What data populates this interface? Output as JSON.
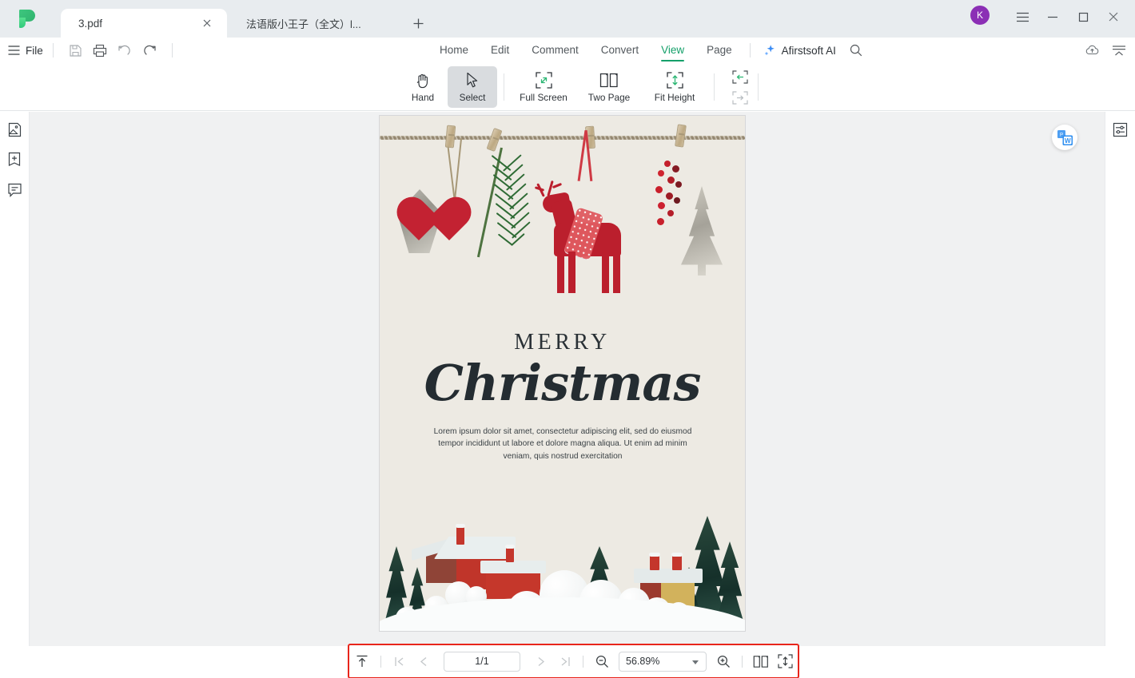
{
  "window": {
    "logo_icon": "afirstsoft-leaf-logo",
    "tabs": [
      {
        "label": "3.pdf",
        "active": true,
        "close_icon": "close-icon"
      },
      {
        "label": "法语版小王子（全文）l...",
        "active": false
      }
    ],
    "new_tab_icon": "plus-icon",
    "avatar_initial": "K",
    "controls": [
      {
        "name": "app-menu",
        "icon": "hamburger-icon"
      },
      {
        "name": "minimize",
        "icon": "minimize-icon"
      },
      {
        "name": "maximize",
        "icon": "maximize-icon"
      },
      {
        "name": "close",
        "icon": "close-icon"
      }
    ]
  },
  "menubar": {
    "hamburger_icon": "hamburger-icon",
    "file_label": "File",
    "quick_icons": [
      {
        "name": "save",
        "icon": "save-icon"
      },
      {
        "name": "print",
        "icon": "print-icon"
      },
      {
        "name": "undo",
        "icon": "undo-icon"
      },
      {
        "name": "redo",
        "icon": "redo-icon"
      }
    ],
    "tabs": [
      {
        "label": "Home",
        "active": false
      },
      {
        "label": "Edit",
        "active": false
      },
      {
        "label": "Comment",
        "active": false
      },
      {
        "label": "Convert",
        "active": false
      },
      {
        "label": "View",
        "active": true
      },
      {
        "label": "Page",
        "active": false
      }
    ],
    "ai_label": "Afirstsoft AI",
    "ai_icon": "sparkle-icon",
    "search_icon": "search-icon",
    "cloud_icon": "cloud-upload-icon",
    "collapse_icon": "collapse-ribbon-icon"
  },
  "ribbon": {
    "tools": [
      {
        "label": "Hand",
        "icon": "hand-icon",
        "selected": false
      },
      {
        "label": "Select",
        "icon": "cursor-arrow-icon",
        "selected": true
      },
      {
        "label": "Full Screen",
        "icon": "full-screen-icon",
        "selected": false
      },
      {
        "label": "Two Page",
        "icon": "two-page-icon",
        "selected": false
      },
      {
        "label": "Fit Height",
        "icon": "fit-height-icon",
        "selected": false
      }
    ],
    "extra_icons": [
      {
        "name": "fit-width-in",
        "icon": "fit-width-icon"
      },
      {
        "name": "fit-width-out",
        "icon": "fit-page-icon"
      }
    ]
  },
  "left_rail": [
    {
      "name": "thumbnails",
      "icon": "thumbnail-image-icon"
    },
    {
      "name": "bookmarks",
      "icon": "bookmark-add-icon"
    },
    {
      "name": "comments",
      "icon": "comment-icon"
    }
  ],
  "right_rail": [
    {
      "name": "properties",
      "icon": "sliders-icon"
    }
  ],
  "canvas": {
    "pdf_to_word_icon": "pdf-to-word-icon",
    "page": {
      "heading_small": "MERRY",
      "heading_large": "Christmas",
      "body": "Lorem ipsum dolor sit amet, consectetur adipiscing elit, sed do eiusmod tempor incididunt ut labore et dolore magna aliqua. Ut enim ad minim veniam, quis nostrud exercitation",
      "background_color": "#edeae3"
    }
  },
  "bottom_bar": {
    "highlight_color": "#e8251b",
    "scroll_top_icon": "scroll-to-top-icon",
    "first_page_icon": "first-page-icon",
    "prev_page_icon": "prev-page-icon",
    "page_value": "1/1",
    "next_page_icon": "next-page-icon",
    "last_page_icon": "last-page-icon",
    "zoom_out_icon": "zoom-out-icon",
    "zoom_value": "56.89%",
    "zoom_dropdown_icon": "chevron-down-icon",
    "zoom_in_icon": "zoom-in-icon",
    "two_page_icon": "two-page-icon",
    "fit_height_icon": "fit-height-icon"
  },
  "theme": {
    "accent_green": "#15a06a",
    "titlebar_bg": "#e8ecef",
    "canvas_bg": "#f0f1f2",
    "avatar_bg": "#8b2fb5"
  }
}
